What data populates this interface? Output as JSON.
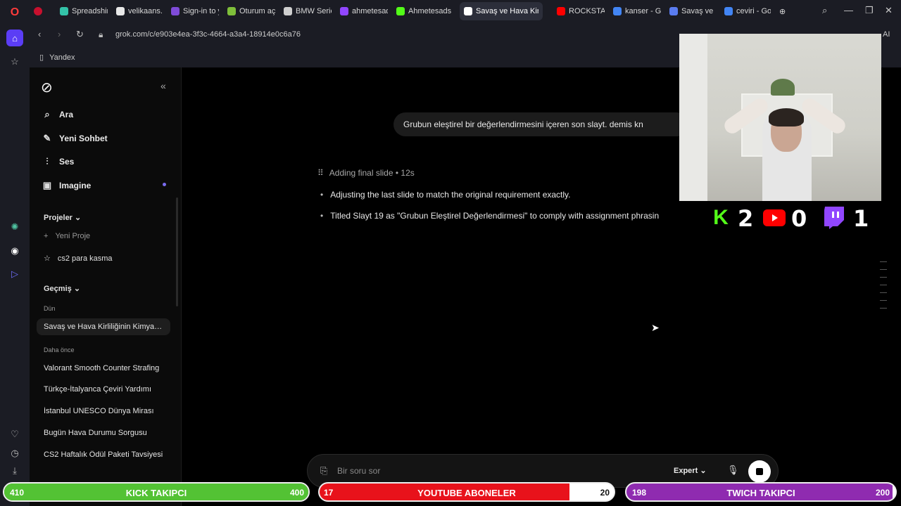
{
  "browser": {
    "tabs": [
      {
        "title": "Spreadshirt",
        "color": "#33c2a8"
      },
      {
        "title": "velikaans.co",
        "color": "#e8e8e8"
      },
      {
        "title": "Sign-in to y",
        "color": "#7f4bd8"
      },
      {
        "title": "Oturum aç",
        "color": "#7fbf3a"
      },
      {
        "title": "BMW Serie",
        "color": "#cfcfcf"
      },
      {
        "title": "ahmetesads",
        "color": "#9146ff"
      },
      {
        "title": "Ahmetesads",
        "color": "#53fc18"
      },
      {
        "title": "Savaş ve Hava Kirliliğ",
        "color": "#ffffff",
        "active": true
      },
      {
        "title": "ROCKSTAR",
        "color": "#ff0000"
      },
      {
        "title": "kanser - Goo",
        "color": "#4285f4"
      },
      {
        "title": "Savaş ve Ha",
        "color": "#5a7cf0"
      },
      {
        "title": "ceviri - Goo",
        "color": "#4285f4"
      }
    ],
    "url": "grok.com/c/e903e4ea-3f3c-4664-a3a4-18914e0c6a76",
    "bookmark": "Yandex",
    "ai_label": "AI"
  },
  "sidebar": {
    "nav": [
      {
        "label": "Ara",
        "icon": "search-icon"
      },
      {
        "label": "Yeni Sohbet",
        "icon": "edit-icon"
      },
      {
        "label": "Ses",
        "icon": "voice-icon"
      },
      {
        "label": "Imagine",
        "icon": "image-icon"
      }
    ],
    "projects_label": "Projeler",
    "new_project": "Yeni Proje",
    "project_item": "cs2 para kasma",
    "history_label": "Geçmiş",
    "group_yesterday": "Dün",
    "selected_chat": "Savaş ve Hava Kirliliğinin Kimyasal Etkileri",
    "group_earlier": "Daha önce",
    "history": [
      "Valorant Smooth Counter Strafing",
      "Türkçe-İtalyanca Çeviri Yardımı",
      "İstanbul UNESCO Dünya Mirası",
      "Bugün Hava Durumu Sorgusu",
      "CS2 Haftalık Ödül Paketi Tavsiyesi"
    ]
  },
  "chat": {
    "user_message": "Grubun eleştirel bir değerlendirmesini içeren son slayt. demis kn",
    "thinking": "Adding final slide • 12s",
    "bullets": [
      "Adjusting the last slide to match the original requirement exactly.",
      "Titled Slayt 19 as \"Grubun Eleştirel Değerlendirmesi\" to comply with assignment phrasin"
    ]
  },
  "input": {
    "placeholder": "Bir soru sor",
    "mode": "Expert"
  },
  "overlay": {
    "kick_count": "2",
    "youtube_count": "0",
    "twitch_count": "1",
    "bars": {
      "kick": {
        "left": "410",
        "label": "KICK TAKIPCI",
        "right": "400",
        "color": "#53c234"
      },
      "youtube": {
        "left": "17",
        "label": "YOUTUBE ABONELER",
        "right": "20",
        "color": "#e8121b"
      },
      "twitch": {
        "left": "198",
        "label": "TWICH TAKIPCI",
        "right": "200",
        "color": "#8f2bb0"
      }
    }
  }
}
